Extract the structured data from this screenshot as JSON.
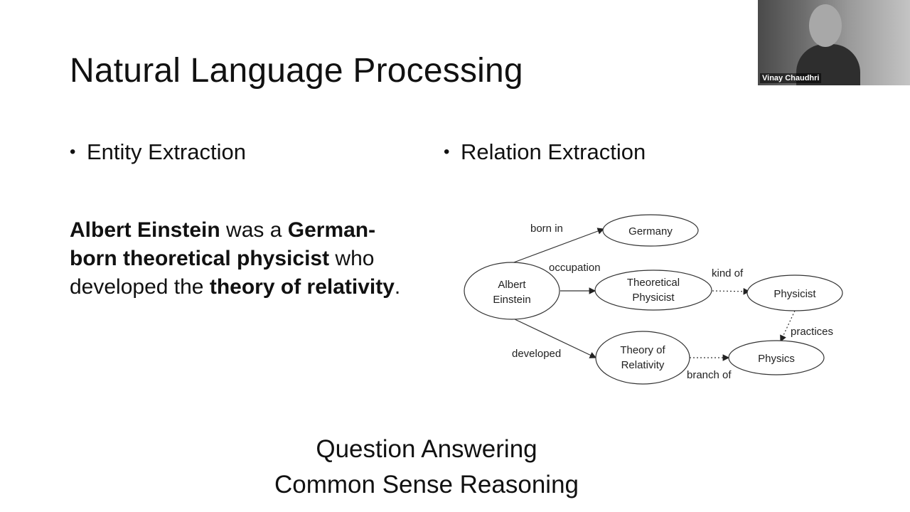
{
  "slide": {
    "title": "Natural Language Processing",
    "bullets": {
      "left": "Entity Extraction",
      "right": "Relation Extraction"
    },
    "paragraph": {
      "s1": "Albert Einstein",
      "s2": " was a ",
      "s3": "German-born theoretical physicist",
      "s4": " who developed the ",
      "s5": "theory of relativity",
      "s6": "."
    },
    "bottom": {
      "line1": "Question Answering",
      "line2": "Common Sense Reasoning"
    }
  },
  "diagram": {
    "nodes": {
      "einstein": [
        "Albert",
        "Einstein"
      ],
      "germany": [
        "Germany"
      ],
      "theoretical_physicist": [
        "Theoretical",
        "Physicist"
      ],
      "physicist": [
        "Physicist"
      ],
      "theory_of_relativity": [
        "Theory of",
        "Relativity"
      ],
      "physics": [
        "Physics"
      ]
    },
    "edges": {
      "born_in": "born in",
      "occupation": "occupation",
      "kind_of": "kind of",
      "practices": "practices",
      "developed": "developed",
      "branch_of": "branch of"
    }
  },
  "webcam": {
    "name": "Vinay Chaudhri"
  }
}
